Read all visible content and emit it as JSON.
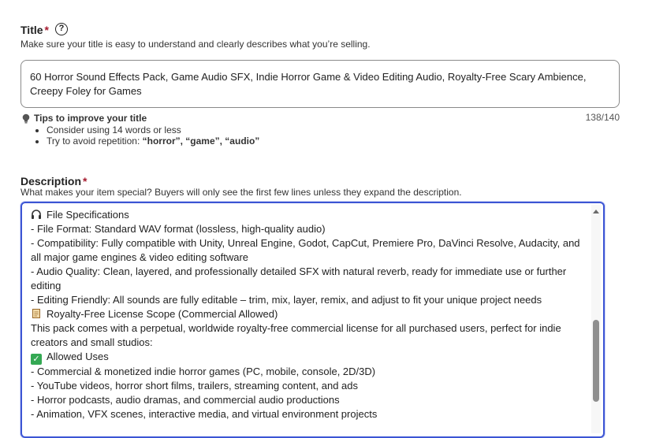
{
  "title_section": {
    "label": "Title",
    "required_mark": "*",
    "help_glyph": "?",
    "help_text": "Make sure your title is easy to understand and clearly describes what you’re selling.",
    "value": "60 Horror Sound Effects Pack, Game Audio SFX, Indie Horror Game & Video Editing Audio, Royalty-Free Scary Ambience, Creepy Foley for Games",
    "char_count": "138/140",
    "tips_heading": "Tips to improve your title",
    "tips": [
      "Consider using 14 words or less",
      "Try to avoid repetition: "
    ],
    "repetition_words": "“horror”, “game”, “audio”"
  },
  "description_section": {
    "label": "Description",
    "required_mark": "*",
    "help_text": "What makes your item special? Buyers will only see the first few lines unless they expand the description.",
    "lines": [
      "File Specifications",
      "- File Format: Standard WAV format (lossless, high-quality audio)",
      "- Compatibility: Fully compatible with Unity, Unreal Engine, Godot, CapCut, Premiere Pro, DaVinci Resolve, Audacity, and all major game engines & video editing software",
      "- Audio Quality: Clean, layered, and professionally detailed SFX with natural reverb, ready for immediate use or further editing",
      "- Editing Friendly: All sounds are fully editable – trim, mix, layer, remix, and adjust to fit your unique project needs",
      "Royalty-Free License Scope (Commercial Allowed)",
      "This pack comes with a perpetual, worldwide royalty-free commercial license for all purchased users, perfect for indie creators and small studios:",
      "Allowed Uses",
      "- Commercial & monetized indie horror games (PC, mobile, console, 2D/3D)",
      "- YouTube videos, horror short films, trailers, streaming content, and ads",
      "- Horror podcasts, audio dramas, and commercial audio productions",
      "- Animation, VFX scenes, interactive media, and virtual environment projects"
    ],
    "icons": [
      "headphones-icon",
      "scroll-icon",
      "check-mark-icon"
    ],
    "scroll_fraction": 0.52
  },
  "colors": {
    "required": "#a61a2e",
    "focus_border": "#3c55d4"
  }
}
